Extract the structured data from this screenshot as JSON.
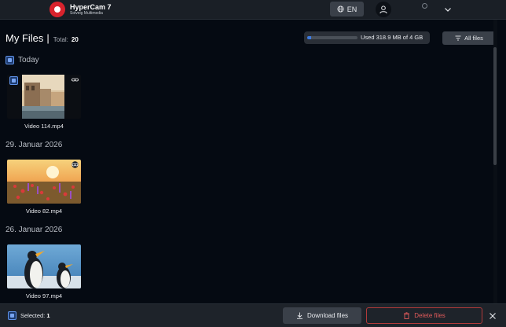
{
  "app": {
    "title": "HyperCam 7",
    "subtitle": "Solveig Multimedia",
    "brand_color": "#d9232d"
  },
  "header": {
    "language": "EN",
    "icons": [
      "globe-icon",
      "user-icon",
      "chevron-down-icon"
    ]
  },
  "page": {
    "title": "My Files",
    "separator": "|",
    "total_label": "Total:",
    "total_count": "20"
  },
  "storage": {
    "text": "Used 318.9 MB of 4 GB",
    "used_fraction": 0.08,
    "accent": "#3d7be0"
  },
  "filter": {
    "label": "All files"
  },
  "groups": [
    {
      "label": "Today",
      "has_checkbox": true,
      "items": [
        {
          "name": "Video 114.mp4",
          "selected": true,
          "thumb": "harbor-buildings"
        }
      ]
    },
    {
      "label": "29. Januar 2026",
      "has_checkbox": false,
      "items": [
        {
          "name": "Video 82.mp4",
          "selected": false,
          "thumb": "sunset-flowers"
        }
      ]
    },
    {
      "label": "26. Januar 2026",
      "has_checkbox": false,
      "items": [
        {
          "name": "Video 97.mp4",
          "selected": false,
          "thumb": "penguins"
        }
      ]
    }
  ],
  "bottom": {
    "selected_label": "Selected:",
    "selected_count": "1",
    "download_label": "Download files",
    "delete_label": "Delete files",
    "delete_color": "#e25b5b"
  }
}
